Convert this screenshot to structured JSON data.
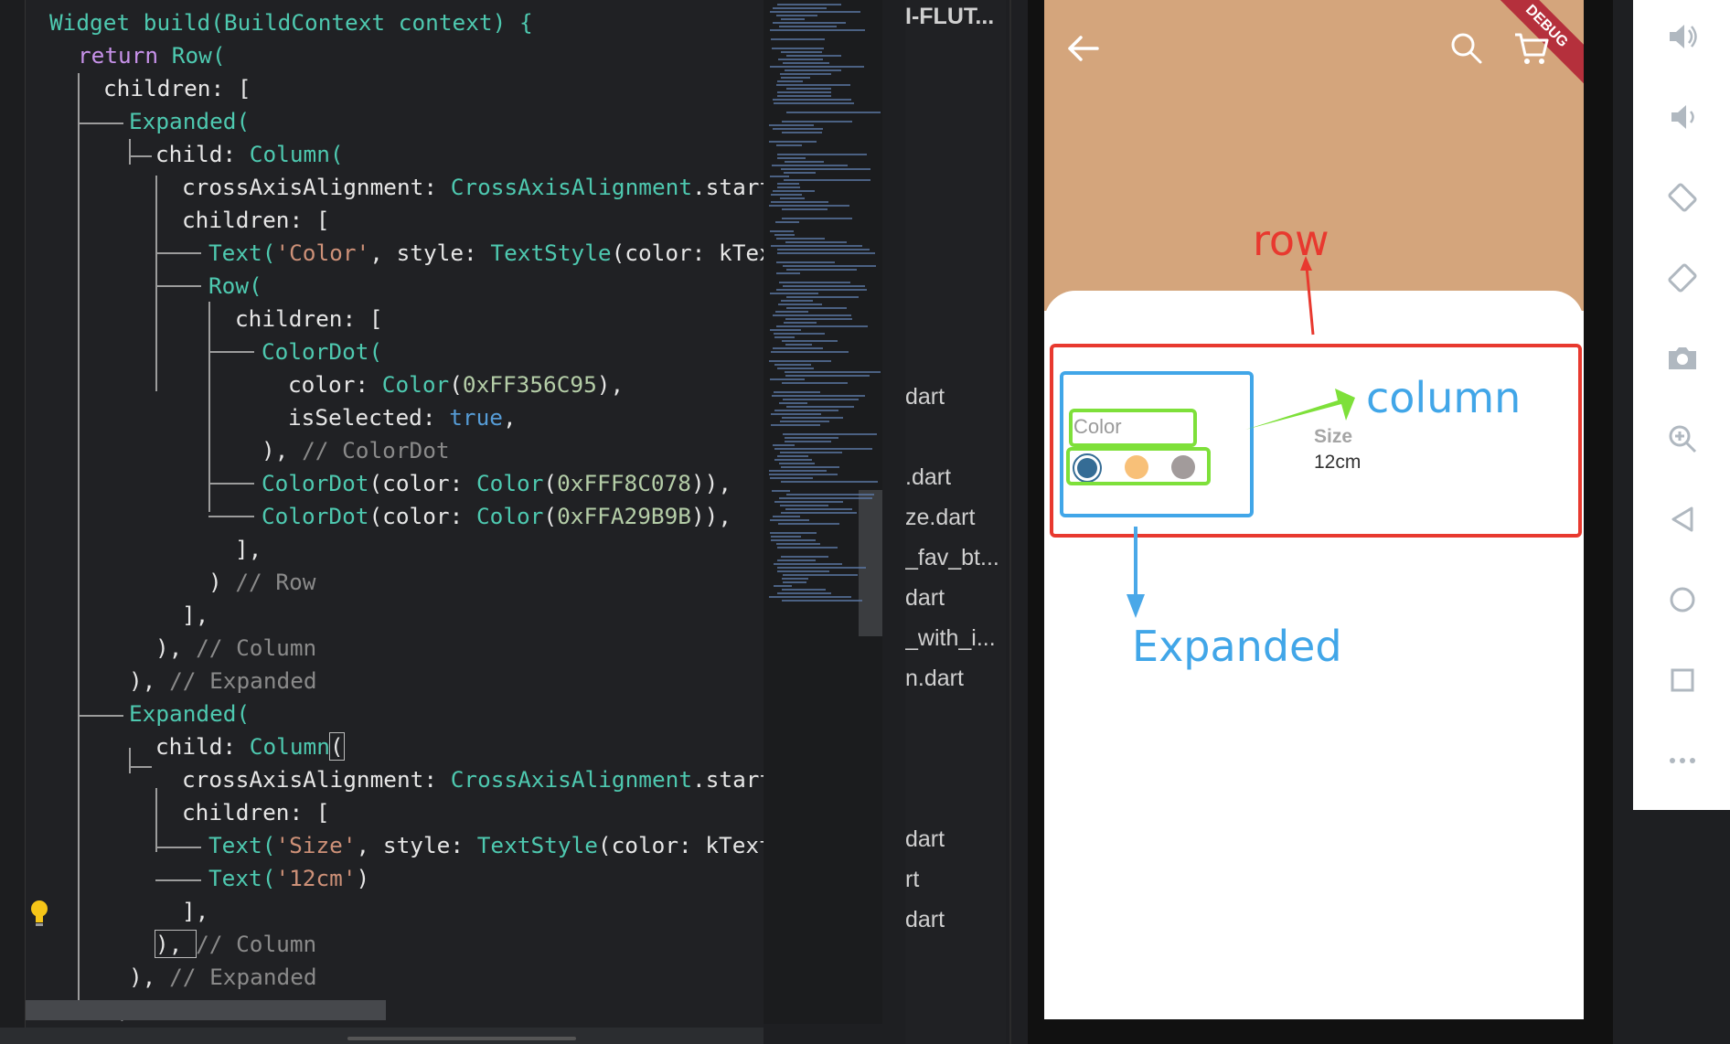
{
  "editor": {
    "lines": {
      "l1": [
        "Widget build(BuildContext context) {"
      ],
      "l2": [
        "return",
        "Row("
      ],
      "l3": [
        "children: ["
      ],
      "l4": [
        "Expanded("
      ],
      "l5": [
        "child: ",
        "Column("
      ],
      "l6": [
        "crossAxisAlignment: ",
        "CrossAxisAlignment",
        ".start"
      ],
      "l7": [
        "children: ["
      ],
      "l8": [
        "Text(",
        "'Color'",
        ", style: ",
        "TextStyle",
        "(color: kTex"
      ],
      "l9": [
        "Row("
      ],
      "l10": [
        "children: ["
      ],
      "l11": [
        "ColorDot("
      ],
      "l12": [
        "color: ",
        "Color",
        "(",
        "0xFF356C95",
        "),"
      ],
      "l13": [
        "isSelected: ",
        "true",
        ","
      ],
      "l14": [
        "), ",
        "// ColorDot"
      ],
      "l15": [
        "ColorDot",
        "(color: ",
        "Color",
        "(",
        "0xFFF8C078",
        ")),"
      ],
      "l16": [
        "ColorDot",
        "(color: ",
        "Color",
        "(",
        "0xFFA29B9B",
        ")),"
      ],
      "l17": [
        "],"
      ],
      "l18": [
        ") ",
        "// Row"
      ],
      "l19": [
        "],"
      ],
      "l20": [
        "), ",
        "// Column"
      ],
      "l21": [
        "), ",
        "// Expanded"
      ],
      "l22": [
        "Expanded("
      ],
      "l23": [
        "child: ",
        "Column",
        "("
      ],
      "l24": [
        "crossAxisAlignment: ",
        "CrossAxisAlignment",
        ".start"
      ],
      "l25": [
        "children: ["
      ],
      "l26": [
        "Text(",
        "'Size'",
        ", style: ",
        "TextStyle",
        "(color: kText"
      ],
      "l27": [
        "Text(",
        "'12cm'",
        ")"
      ],
      "l28": [
        "],"
      ],
      "l29": [
        "), ",
        "// Column"
      ],
      "l30": [
        "), ",
        "// Expanded"
      ],
      "l31": [
        "],"
      ]
    }
  },
  "explorer": {
    "files": [
      "I-FLUT...",
      "dart",
      ".dart",
      "ze.dart",
      "_fav_bt...",
      "dart",
      "_with_i...",
      "n.dart",
      "dart",
      "rt",
      "dart"
    ]
  },
  "app": {
    "debug_label": "DEBUG",
    "color_label": "Color",
    "size_label": "Size",
    "size_value": "12cm",
    "dots": [
      "#356C95",
      "#F8C078",
      "#A29B9B"
    ]
  },
  "annotations": {
    "row": "row",
    "column": "column",
    "expanded": "Expanded",
    "colors": {
      "row": "#e8392f",
      "column": "#41a6e8",
      "expanded": "#4aa8e8",
      "child": "#7ee03a"
    }
  },
  "toolbar": {
    "icons": [
      "volume-up-icon",
      "volume-down-icon",
      "rotate-left-icon",
      "rotate-right-icon",
      "camera-icon",
      "zoom-icon",
      "back-icon",
      "home-icon",
      "overview-icon",
      "more-icon"
    ]
  }
}
